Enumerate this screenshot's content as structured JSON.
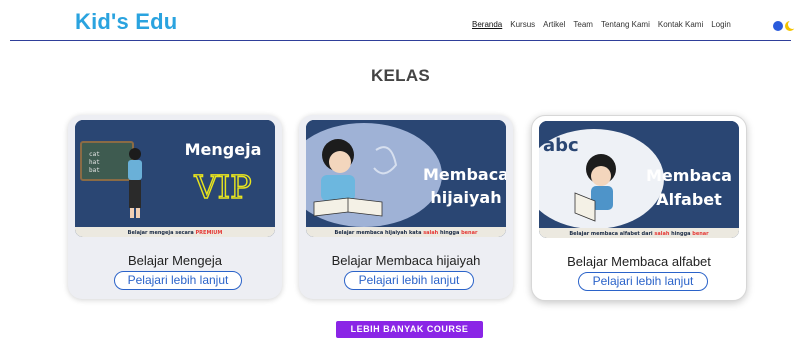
{
  "header": {
    "logo": "Kid's Edu",
    "menu": [
      "Beranda",
      "Kursus",
      "Artikel",
      "Team",
      "Tentang Kami",
      "Kontak Kami",
      "Login"
    ]
  },
  "section": {
    "title": "KELAS"
  },
  "courses": [
    {
      "title": "Belajar Mengeja",
      "button": "Pelajari lebih lanjut",
      "thumb": {
        "line1": "Mengeja",
        "line2": "VIP",
        "chalk": [
          "cat",
          "hat",
          "bat"
        ],
        "caption": "Belajar mengeja secara",
        "caption_hl": "PREMIUM"
      }
    },
    {
      "title": "Belajar Membaca hijaiyah",
      "button": "Pelajari lebih lanjut",
      "thumb": {
        "line1": "Membaca",
        "line2": "hijaiyah",
        "caption": "Belajar membaca hijaiyah kata",
        "caption_hl": "salah",
        "caption_mid": "hingga",
        "caption_hl2": "benar"
      }
    },
    {
      "title": "Belajar Membaca alfabet",
      "button": "Pelajari lebih lanjut",
      "thumb": {
        "line1": "Membaca",
        "line2": "Alfabet",
        "abc": "abc",
        "caption": "Belajar membaca alfabet dari",
        "caption_hl": "salah",
        "caption_mid": "hingga",
        "caption_hl2": "benar"
      }
    }
  ],
  "more_button": "LEBIH BANYAK COURSE",
  "colors": {
    "brand": "#2aa3df",
    "button_outline": "#2b63c9",
    "accent_purple": "#8a25e6",
    "thumb_bg": "#2a4673"
  }
}
